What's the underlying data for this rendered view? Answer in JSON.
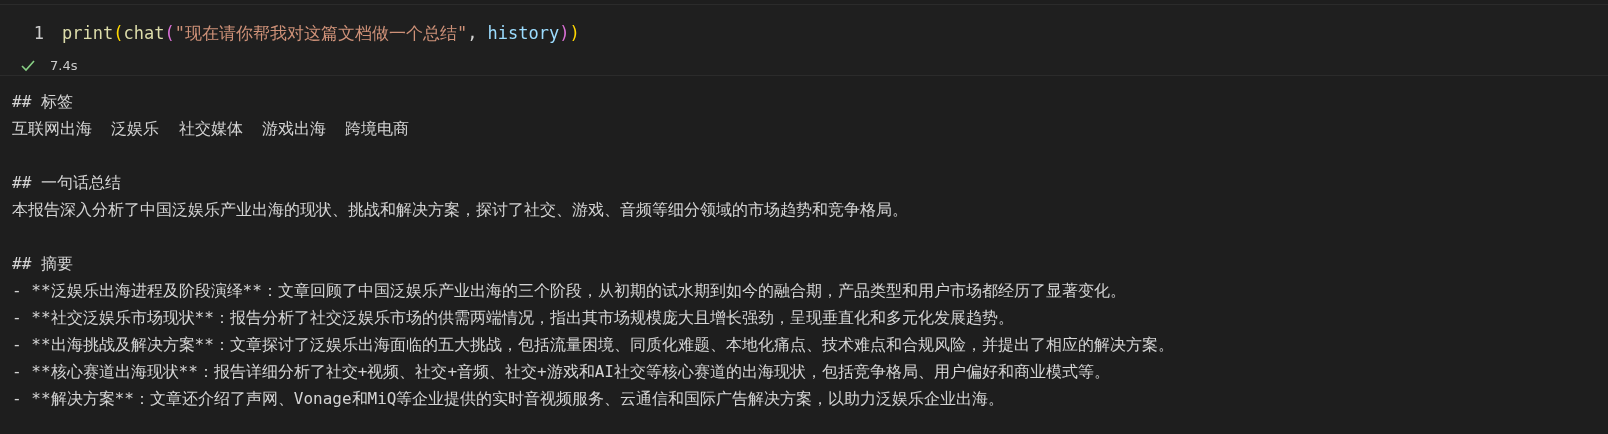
{
  "cell": {
    "line_number": "1",
    "code": [
      {
        "kind": "function",
        "text": "print"
      },
      {
        "kind": "paren1",
        "text": "("
      },
      {
        "kind": "function",
        "text": "chat"
      },
      {
        "kind": "paren2",
        "text": "("
      },
      {
        "kind": "string",
        "text": "\"现在请你帮我对这篇文档做一个总结\""
      },
      {
        "kind": "plain",
        "text": ", "
      },
      {
        "kind": "variable",
        "text": "history"
      },
      {
        "kind": "paren2",
        "text": ")"
      },
      {
        "kind": "paren1",
        "text": ")"
      }
    ],
    "status": {
      "success": true,
      "time": "7.4s"
    }
  },
  "output": [
    {
      "lines": [
        "## 标签",
        "互联网出海  泛娱乐  社交媒体  游戏出海  跨境电商"
      ]
    },
    {
      "lines": [
        "## 一句话总结",
        "本报告深入分析了中国泛娱乐产业出海的现状、挑战和解决方案，探讨了社交、游戏、音频等细分领域的市场趋势和竞争格局。"
      ]
    },
    {
      "lines": [
        "## 摘要",
        "- **泛娱乐出海进程及阶段演绎**：文章回顾了中国泛娱乐产业出海的三个阶段，从初期的试水期到如今的融合期，产品类型和用户市场都经历了显著变化。",
        "- **社交泛娱乐市场现状**：报告分析了社交泛娱乐市场的供需两端情况，指出其市场规模庞大且增长强劲，呈现垂直化和多元化发展趋势。",
        "- **出海挑战及解决方案**：文章探讨了泛娱乐出海面临的五大挑战，包括流量困境、同质化难题、本地化痛点、技术难点和合规风险，并提出了相应的解决方案。",
        "- **核心赛道出海现状**：报告详细分析了社交+视频、社交+音频、社交+游戏和AI社交等核心赛道的出海现状，包括竞争格局、用户偏好和商业模式等。",
        "- **解决方案**：文章还介绍了声网、Vonage和MiQ等企业提供的实时音视频服务、云通信和国际广告解决方案，以助力泛娱乐企业出海。"
      ]
    }
  ]
}
